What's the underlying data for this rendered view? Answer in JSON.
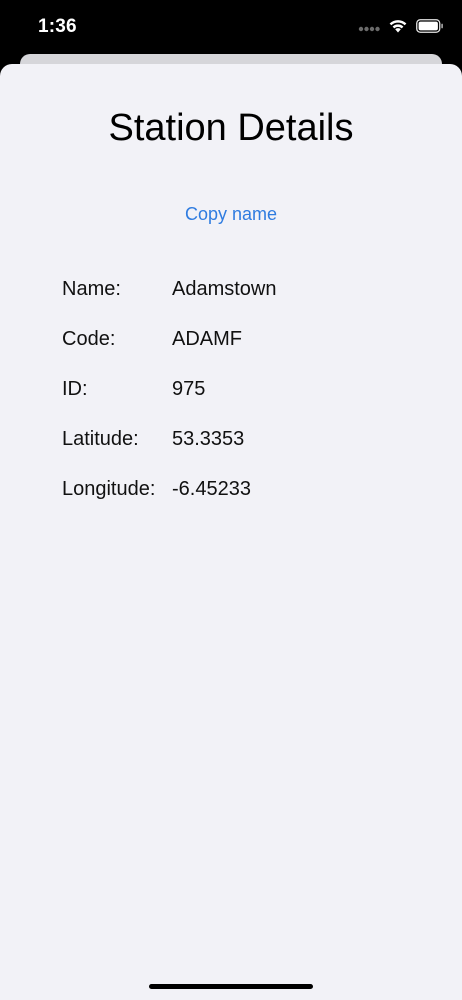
{
  "status_bar": {
    "time": "1:36",
    "icons": [
      "signal-dots-icon",
      "wifi-icon",
      "battery-icon"
    ]
  },
  "page": {
    "title": "Station Details",
    "copy_button_label": "Copy name"
  },
  "details": [
    {
      "label": "Name:",
      "value": "Adamstown"
    },
    {
      "label": "Code:",
      "value": "ADAMF"
    },
    {
      "label": "ID:",
      "value": "975"
    },
    {
      "label": "Latitude:",
      "value": "53.3353"
    },
    {
      "label": "Longitude:",
      "value": "-6.45233"
    }
  ],
  "colors": {
    "accent": "#2f7ce0",
    "sheet_background": "#f2f2f7",
    "status_bar_background": "#000000"
  }
}
